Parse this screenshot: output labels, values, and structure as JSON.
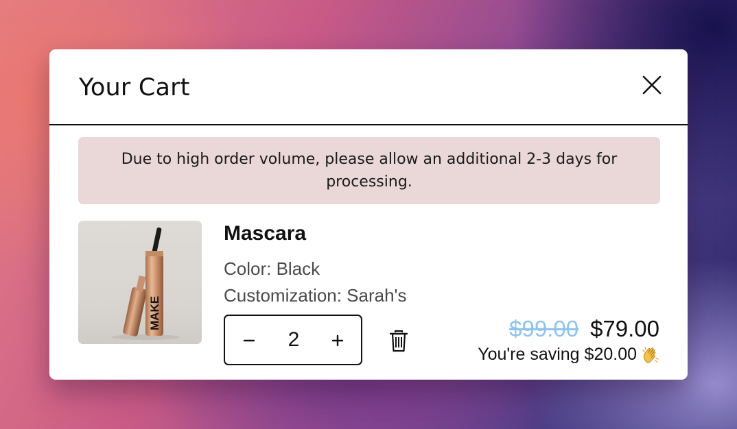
{
  "cart": {
    "title": "Your Cart",
    "notice": "Due to high order volume, please allow an additional 2-3 days for processing."
  },
  "item": {
    "name": "Mascara",
    "color": "Color: Black",
    "customization": "Customization: Sarah's",
    "image_text": "MAKE",
    "quantity": "2",
    "original_price": "$99.00",
    "price": "$79.00",
    "savings": "You're saving $20.00"
  },
  "icons": {
    "close": "close-icon",
    "minus": "minus-icon",
    "plus": "plus-icon",
    "trash": "trash-icon",
    "clap": "clapping-hands-icon"
  },
  "colors": {
    "notice_bg": "#ead7d8",
    "strike_price": "#8ec3ef",
    "text": "#111111"
  }
}
